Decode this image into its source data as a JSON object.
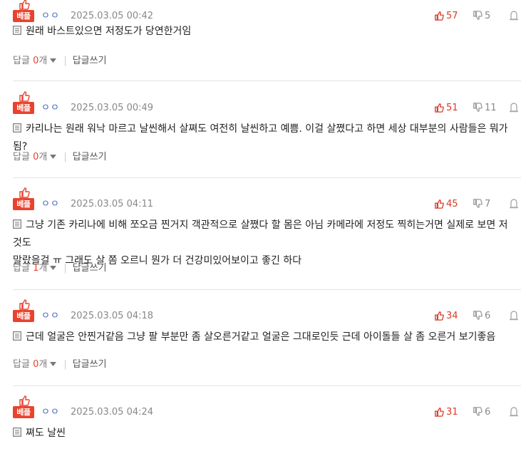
{
  "comments": [
    {
      "best_label": "베플",
      "author": "ㅇㅇ",
      "date": "2025.03.05 00:42",
      "up": "57",
      "down": "5",
      "text": "원래 바스트있으면 저정도가 당연한거임",
      "reply_label": "답글",
      "reply_count": "0",
      "reply_unit": "개",
      "write_label": "답글쓰기"
    },
    {
      "best_label": "베플",
      "author": "ㅇㅇ",
      "date": "2025.03.05 00:49",
      "up": "51",
      "down": "11",
      "text": "카리나는 원래 워낙 마르고 날씬해서 살쪄도 여전히 날씬하고 예쁨. 이걸 살쪘다고 하면 세상 대부분의 사람들은 뭐가 됨?",
      "reply_label": "답글",
      "reply_count": "0",
      "reply_unit": "개",
      "write_label": "답글쓰기"
    },
    {
      "best_label": "베플",
      "author": "ㅇㅇ",
      "date": "2025.03.05 04:11",
      "up": "45",
      "down": "7",
      "text_line1": "그냥 기존 카리나에 비해 쪼오금 찐거지 객관적으로 살쪘다 할 몸은 아님 카메라에 저정도 찍히는거면 실제로 보면 저것도",
      "text_line2": "말랐을걸 ㅠ 그래도 살 쫌 오르니 뭔가 더 건강미있어보이고 좋긴 하다",
      "reply_label": "답글",
      "reply_count": "1",
      "reply_unit": "개",
      "write_label": "답글쓰기"
    },
    {
      "best_label": "베플",
      "author": "ㅇㅇ",
      "date": "2025.03.05 04:18",
      "up": "34",
      "down": "6",
      "text": "근데 얼굴은 안찐거같음 그냥 팔 부분만 좀 살오른거같고 얼굴은 그대로인듯 근데 아이돌들 살 좀 오른거 보기좋음",
      "reply_label": "답글",
      "reply_count": "0",
      "reply_unit": "개",
      "write_label": "답글쓰기"
    },
    {
      "best_label": "베플",
      "author": "ㅇㅇ",
      "date": "2025.03.05 04:24",
      "up": "31",
      "down": "6",
      "text": "쪄도 날씬"
    }
  ],
  "icons": {
    "best": "thumbs-up-icon",
    "up": "thumbs-up-icon",
    "down": "thumbs-down-icon",
    "report": "report-icon",
    "doc": "document-icon",
    "caret": "caret-down-icon"
  },
  "colors": {
    "accent": "#e8432e",
    "author": "#3b63b8",
    "muted": "#888888"
  }
}
